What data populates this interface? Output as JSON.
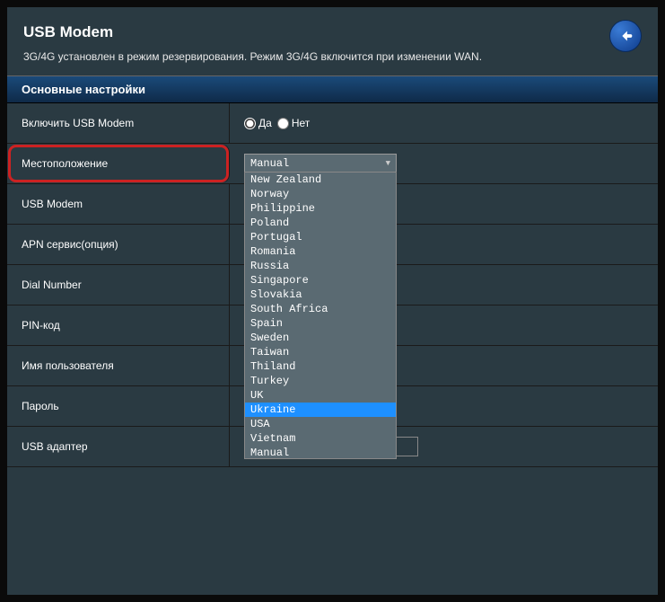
{
  "header": {
    "title": "USB Modem",
    "info_text": "3G/4G установлен в режим резервирования. Режим 3G/4G включится при изменении WAN."
  },
  "section": {
    "heading": "Основные настройки"
  },
  "rows": {
    "enable": {
      "label": "Включить USB Modem",
      "yes": "Да",
      "no": "Нет"
    },
    "location": {
      "label": "Местоположение",
      "value": "Manual"
    },
    "usb_modem": {
      "label": "USB Modem"
    },
    "apn": {
      "label": "APN сервис(опция)"
    },
    "dial": {
      "label": "Dial Number"
    },
    "pin": {
      "label": "PIN-код"
    },
    "username": {
      "label": "Имя пользователя"
    },
    "password": {
      "label": "Пароль"
    },
    "adapter": {
      "label": "USB адаптер"
    }
  },
  "dropdown": {
    "selected": "Ukraine",
    "options": [
      "New Zealand",
      "Norway",
      "Philippine",
      "Poland",
      "Portugal",
      "Romania",
      "Russia",
      "Singapore",
      "Slovakia",
      "South Africa",
      "Spain",
      "Sweden",
      "Taiwan",
      "Thiland",
      "Turkey",
      "UK",
      "Ukraine",
      "USA",
      "Vietnam",
      "Manual"
    ]
  }
}
